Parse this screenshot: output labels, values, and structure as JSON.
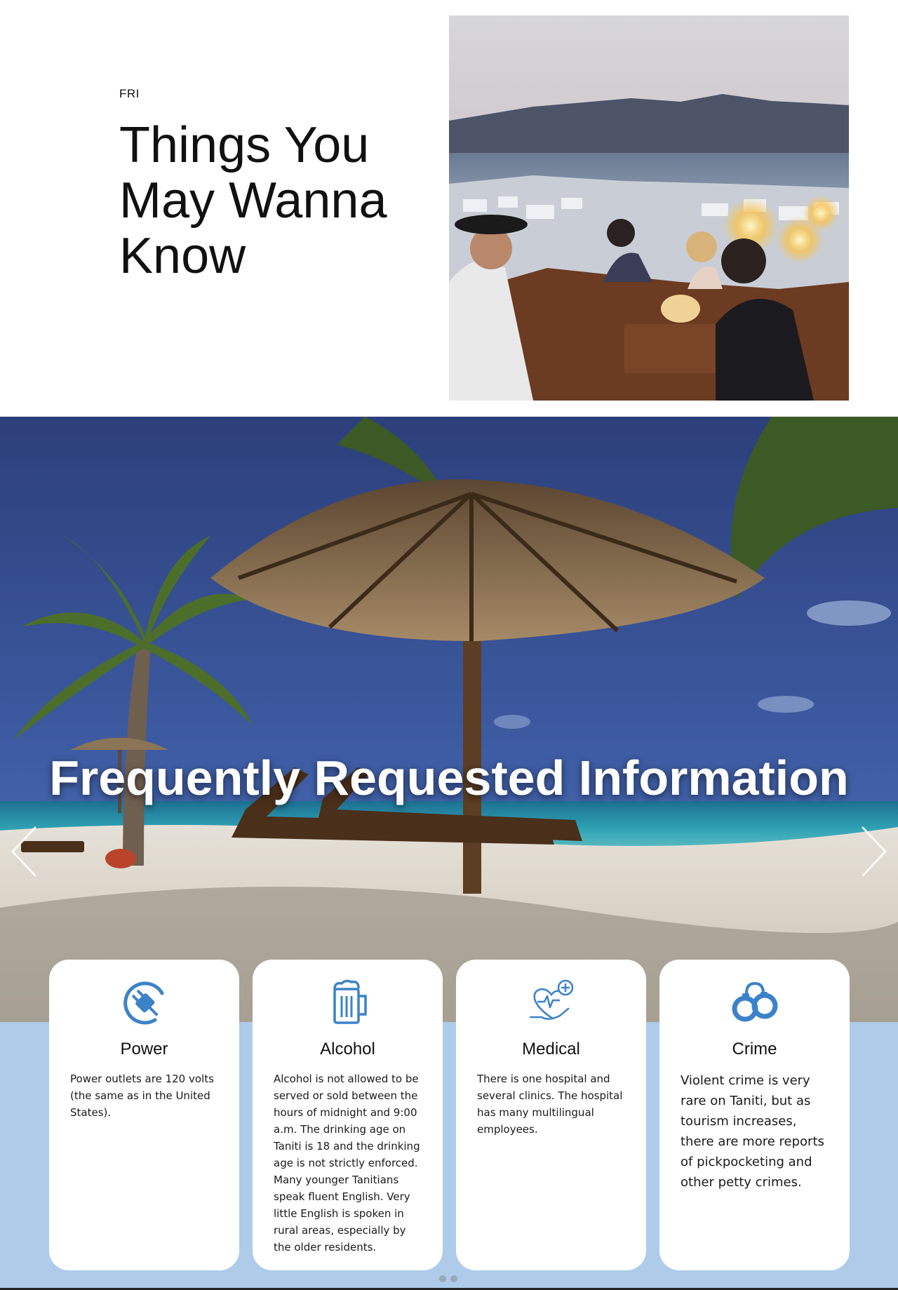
{
  "intro": {
    "day_label": "FRI",
    "title": "Things You May Wanna Know"
  },
  "hero": {
    "title": "Frequently Requested Information"
  },
  "cards": [
    {
      "icon": "power-plug-icon",
      "title": "Power",
      "text": "Power outlets are 120 volts (the same as in the United States)."
    },
    {
      "icon": "beer-mug-icon",
      "title": "Alcohol",
      "text": "Alcohol is not allowed to be served or sold between the hours of midnight and 9:00 a.m. The drinking age on Taniti is 18 and the drinking age is not strictly enforced. Many younger Tanitians speak fluent English. Very little English is spoken in rural areas, especially by the older residents."
    },
    {
      "icon": "medical-heart-icon",
      "title": "Medical",
      "text": "There is one hospital and several clinics. The hospital has many multilingual employees."
    },
    {
      "icon": "handcuffs-icon",
      "title": "Crime",
      "text": "Violent crime is very rare on Taniti, but as tourism increases, there are more reports of pickpocketing and other petty crimes."
    }
  ],
  "colors": {
    "band": "#aecbea",
    "icon": "#3c82c8",
    "card": "#ffffff"
  }
}
